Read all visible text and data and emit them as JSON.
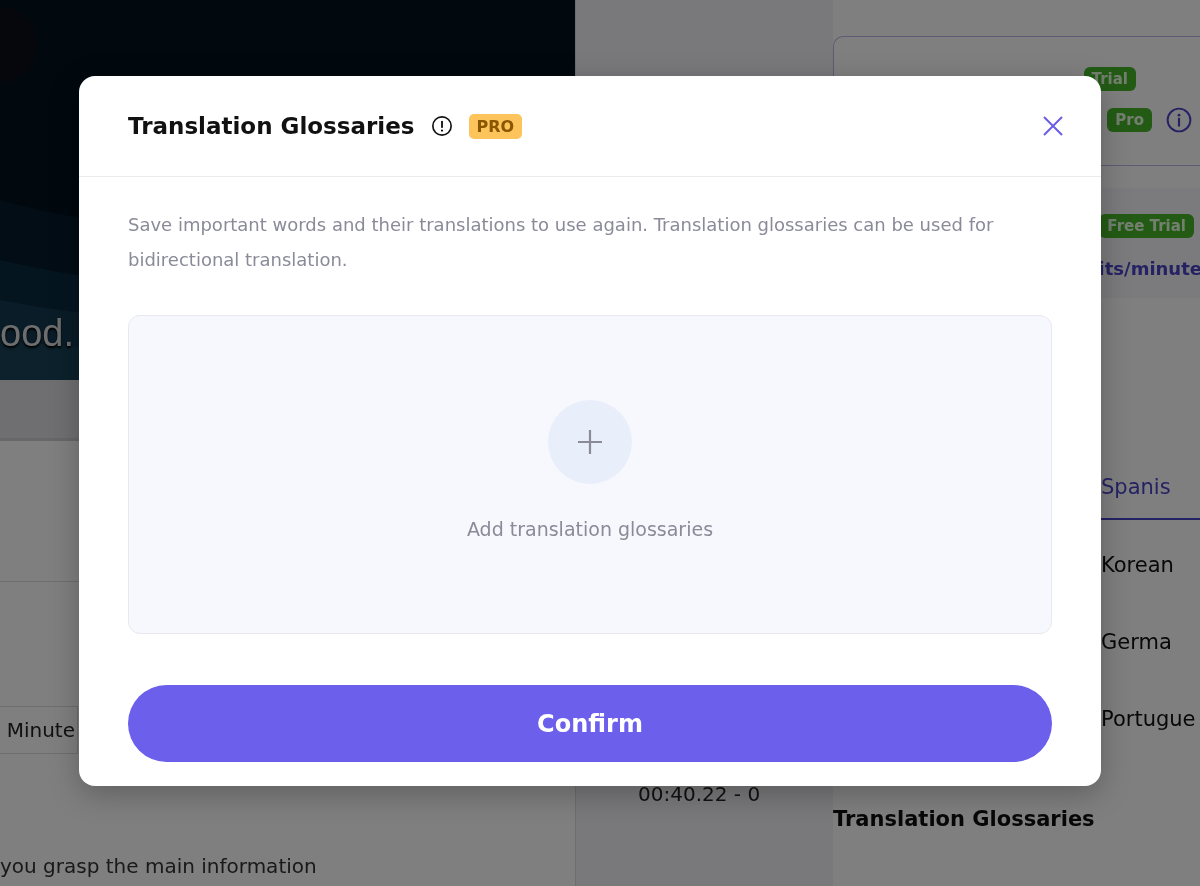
{
  "background": {
    "video": {
      "caption": "ood."
    },
    "duration_field": {
      "value": "Minute"
    },
    "transcript_text": "you grasp the main information",
    "timestamp": "00:40.22 - 0",
    "plan_badges": [
      {
        "label": "Trial"
      },
      {
        "label": "Pro"
      }
    ],
    "trial_badge": "Free Trial",
    "rate_text": "its/minute",
    "languages": [
      {
        "label": "Spanis",
        "selected": true
      },
      {
        "label": "Korean",
        "selected": false
      },
      {
        "label": "Germa",
        "selected": false
      },
      {
        "label": "Portugue",
        "selected": false
      }
    ],
    "section_title": "Translation Glossaries"
  },
  "modal": {
    "title": "Translation Glossaries",
    "badge": "PRO",
    "description": "Save important words and their translations to use again. Translation glossaries can be used for bidirectional translation.",
    "add_label": "Add translation glossaries",
    "confirm": "Confirm"
  }
}
